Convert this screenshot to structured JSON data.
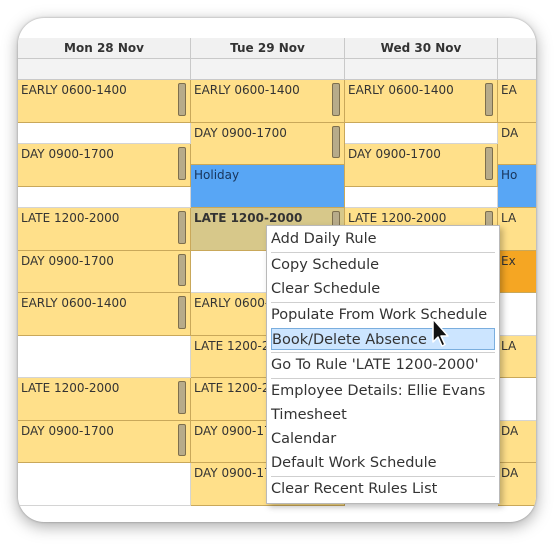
{
  "columns": [
    "Mon 28 Nov",
    "Tue 29 Nov",
    "Wed 30 Nov",
    ""
  ],
  "rows": {
    "r1": {
      "mon": "EARLY 0600-1400",
      "tue": "EARLY 0600-1400",
      "wed": "EARLY 0600-1400",
      "thu": "EA"
    },
    "r2": {
      "tue": "DAY 0900-1700",
      "thu": "DA"
    },
    "r3": {
      "mon": "DAY 0900-1700",
      "wed": "DAY 0900-1700"
    },
    "r4": {
      "tue": "Holiday",
      "thu": "Ho"
    },
    "r5": {
      "mon": "LATE 1200-2000",
      "tue": "LATE 1200-2000",
      "wed": "LATE 1200-2000",
      "thu": "LA"
    },
    "r6": {
      "mon": "DAY 0900-1700",
      "thu": "Ex"
    },
    "r7": {
      "mon": "EARLY 0600-1400",
      "tue": "EARLY 0600-"
    },
    "r8": {
      "tue": "LATE 1200-2",
      "thu": "LA"
    },
    "r9": {
      "mon": "LATE 1200-2000",
      "tue": "LATE 1200-2"
    },
    "r10": {
      "mon": "DAY 0900-1700",
      "tue": "DAY 0900-17",
      "thu": "DA"
    },
    "r11": {
      "tue": "DAY 0900-17",
      "thu": "DA"
    }
  },
  "menu": {
    "items": [
      "Add Daily Rule",
      "Copy Schedule",
      "Clear Schedule",
      "Populate From Work Schedule",
      "Book/Delete Absence",
      "Go To Rule 'LATE 1200-2000'",
      "Employee Details: Ellie Evans",
      "Timesheet",
      "Calendar",
      "Default Work Schedule",
      "Clear Recent Rules List"
    ]
  },
  "colors": {
    "shift": "#ffe08a",
    "holiday": "#58a6f5",
    "extra": "#f5a623",
    "highlight": "#cce5ff"
  }
}
